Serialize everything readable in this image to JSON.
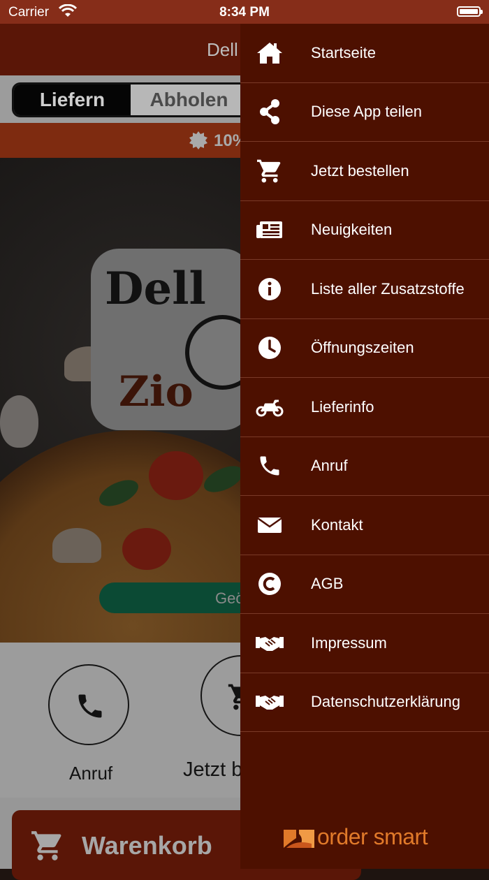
{
  "status_bar": {
    "carrier": "Carrier",
    "time": "8:34 PM"
  },
  "app": {
    "title": "Dell",
    "segment": {
      "deliver": "Liefern",
      "pickup": "Abholen"
    },
    "promo": "10%",
    "hero": {
      "logo_top": "Dell",
      "logo_bottom": "Zio",
      "open_status": "Geö"
    },
    "actions": [
      {
        "label": "Anruf",
        "icon": "phone-icon"
      },
      {
        "label": "Jetzt b",
        "icon": "cart-icon"
      }
    ],
    "cart_label": "Warenkorb"
  },
  "drawer": {
    "items": [
      {
        "label": "Startseite",
        "icon": "home-icon"
      },
      {
        "label": "Diese App teilen",
        "icon": "share-icon"
      },
      {
        "label": "Jetzt bestellen",
        "icon": "cart-icon"
      },
      {
        "label": "Neuigkeiten",
        "icon": "newspaper-icon"
      },
      {
        "label": "Liste aller Zusatzstoffe",
        "icon": "info-icon"
      },
      {
        "label": "Öffnungszeiten",
        "icon": "clock-icon"
      },
      {
        "label": "Lieferinfo",
        "icon": "motorcycle-icon"
      },
      {
        "label": "Anruf",
        "icon": "phone-icon"
      },
      {
        "label": "Kontakt",
        "icon": "envelope-icon"
      },
      {
        "label": "AGB",
        "icon": "copyright-icon"
      },
      {
        "label": "Impressum",
        "icon": "handshake-icon"
      },
      {
        "label": "Datenschutzerklärung",
        "icon": "handshake-icon"
      }
    ],
    "brand": "order smart"
  },
  "colors": {
    "drawer_bg": "#4d1000",
    "accent": "#e17a2a",
    "nav_bg": "#5a1607"
  }
}
